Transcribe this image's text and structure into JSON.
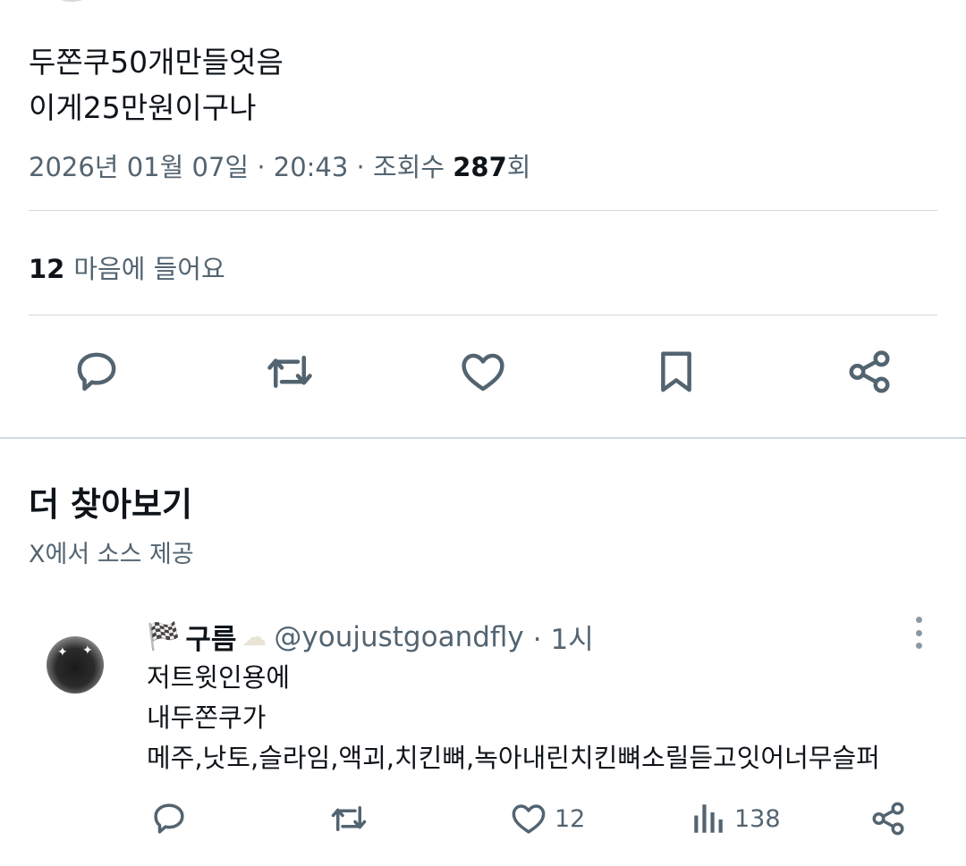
{
  "tweet": {
    "lines": [
      "두쫀쿠50개만들엇음",
      "이게25만원이구나"
    ],
    "date": "2026년 01월 07일",
    "time": "20:43",
    "views_label": "조회수",
    "views_count": "287",
    "views_suffix": "회",
    "likes_count": "12",
    "likes_label": "마음에 들어요",
    "separator": "·"
  },
  "explore": {
    "title": "더 찾아보기",
    "subtitle": "X에서 소스 제공"
  },
  "related_post": {
    "flag": "🏁",
    "name": "구름",
    "cloud": "☁",
    "handle": "@youjustgoandfly",
    "separator": "·",
    "time": "1시",
    "lines": [
      "저트윗인용에",
      "내두쫀쿠가",
      "메주,낫토,슬라임,액괴,치킨뼈,녹아내린치킨뼈소릴듣고잇어너무슬퍼"
    ],
    "like_count": "12",
    "view_count": "138"
  },
  "icons": {
    "reply": "reply-icon",
    "retweet": "retweet-icon",
    "like": "heart-icon",
    "bookmark": "bookmark-icon",
    "share": "share-icon",
    "views": "views-icon",
    "more": "more-options-icon"
  },
  "colors": {
    "text": "#0f1419",
    "secondary": "#536471",
    "divider": "#cfd9de",
    "icon": "#536471"
  }
}
